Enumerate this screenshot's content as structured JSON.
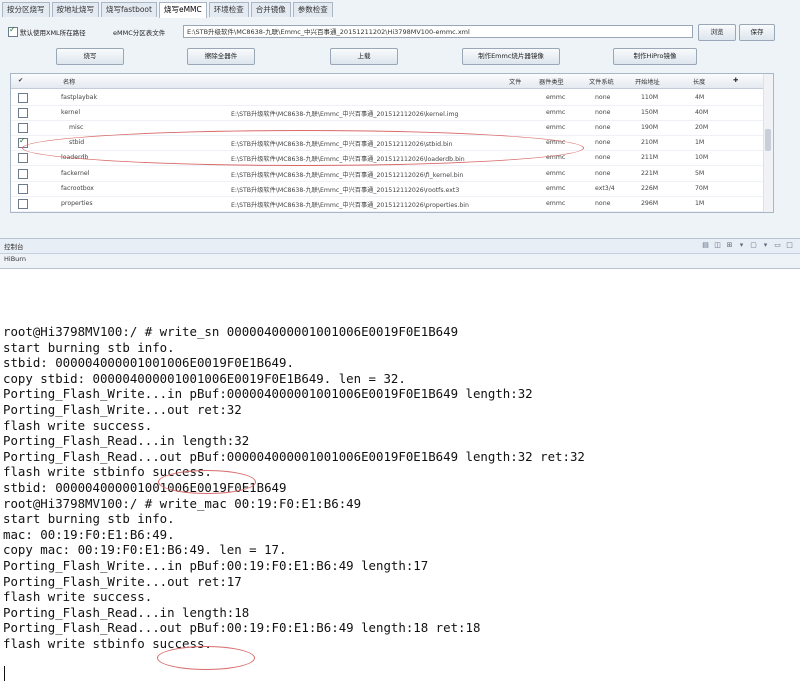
{
  "tabs": [
    {
      "label": "按分区烧写",
      "active": false
    },
    {
      "label": "按地址烧写",
      "active": false
    },
    {
      "label": "烧写fastboot",
      "active": false
    },
    {
      "label": "烧写eMMC",
      "active": true
    },
    {
      "label": "环境检查",
      "active": false
    },
    {
      "label": "合并镜像",
      "active": false
    },
    {
      "label": "参数检查",
      "active": false
    }
  ],
  "path_row": {
    "checkbox_label": "默认使用XML所在路径",
    "table_label": "eMMC分区表文件",
    "path_value": "E:\\STB升级软件\\MC8638-九联\\Emmc_中兴百事通_20151211202\\Hi3798MV100-emmc.xml",
    "browse_label": "浏览",
    "save_label": "保存"
  },
  "actions": {
    "burn": "烧写",
    "erase": "擦除全器件",
    "upload": "上载",
    "make_emmc": "制作Emmc烧片器镜像",
    "make_hipro": "制作HiPro镜像"
  },
  "grid": {
    "columns": [
      "名称",
      "文件",
      "器件类型",
      "文件系统",
      "开始地址",
      "长度"
    ],
    "rows": [
      {
        "checked": false,
        "name": "fastplaybak",
        "file": "",
        "device": "emmc",
        "fs": "none",
        "start": "110M",
        "length": "4M"
      },
      {
        "checked": false,
        "name": "kernel",
        "file": "E:\\STB升级软件\\MC8638-九联\\Emmc_中兴百事通_201512112026\\kernel.img",
        "device": "emmc",
        "fs": "none",
        "start": "150M",
        "length": "40M"
      },
      {
        "checked": false,
        "name": "misc",
        "file": "",
        "device": "emmc",
        "fs": "none",
        "start": "190M",
        "length": "20M"
      },
      {
        "checked": true,
        "name": "stbid",
        "file": "E:\\STB升级软件\\MC8638-九联\\Emmc_中兴百事通_201512112026\\stbid.bin",
        "device": "emmc",
        "fs": "none",
        "start": "210M",
        "length": "1M"
      },
      {
        "checked": false,
        "name": "loaderdb",
        "file": "E:\\STB升级软件\\MC8638-九联\\Emmc_中兴百事通_201512112026\\loaderdb.bin",
        "device": "emmc",
        "fs": "none",
        "start": "211M",
        "length": "10M"
      },
      {
        "checked": false,
        "name": "fackernel",
        "file": "E:\\STB升级软件\\MC8638-九联\\Emmc_中兴百事通_201512112026\\fi_kernel.bin",
        "device": "emmc",
        "fs": "none",
        "start": "221M",
        "length": "5M"
      },
      {
        "checked": false,
        "name": "facrootbox",
        "file": "E:\\STB升级软件\\MC8638-九联\\Emmc_中兴百事通_201512112026\\rootfs.ext3",
        "device": "emmc",
        "fs": "ext3/4",
        "start": "226M",
        "length": "70M"
      },
      {
        "checked": false,
        "name": "properties",
        "file": "E:\\STB升级软件\\MC8638-九联\\Emmc_中兴百事通_201512112026\\properties.bin",
        "device": "emmc",
        "fs": "none",
        "start": "296M",
        "length": "1M"
      }
    ]
  },
  "console": {
    "title": "控制台",
    "subtitle": "HiBurn"
  },
  "terminal": [
    "root@Hi3798MV100:/ # write_sn 000004000001001006E0019F0E1B649",
    "start burning stb info.",
    "stbid: 000004000001001006E0019F0E1B649.",
    "copy stbid: 000004000001001006E0019F0E1B649. len = 32.",
    "Porting_Flash_Write...in pBuf:000004000001001006E0019F0E1B649 length:32",
    "Porting_Flash_Write...out ret:32",
    "flash write success.",
    "Porting_Flash_Read...in length:32",
    "Porting_Flash_Read...out pBuf:000004000001001006E0019F0E1B649 length:32 ret:32",
    "flash write stbinfo success.",
    "stbid: 000004000001001006E0019F0E1B649",
    "root@Hi3798MV100:/ # write_mac 00:19:F0:E1:B6:49",
    "start burning stb info.",
    "mac: 00:19:F0:E1:B6:49.",
    "copy mac: 00:19:F0:E1:B6:49. len = 17.",
    "Porting_Flash_Write...in pBuf:00:19:F0:E1:B6:49 length:17",
    "Porting_Flash_Write...out ret:17",
    "flash write success.",
    "Porting_Flash_Read...in length:18",
    "Porting_Flash_Read...out pBuf:00:19:F0:E1:B6:49 length:18 ret:18",
    "flash write stbinfo success."
  ]
}
